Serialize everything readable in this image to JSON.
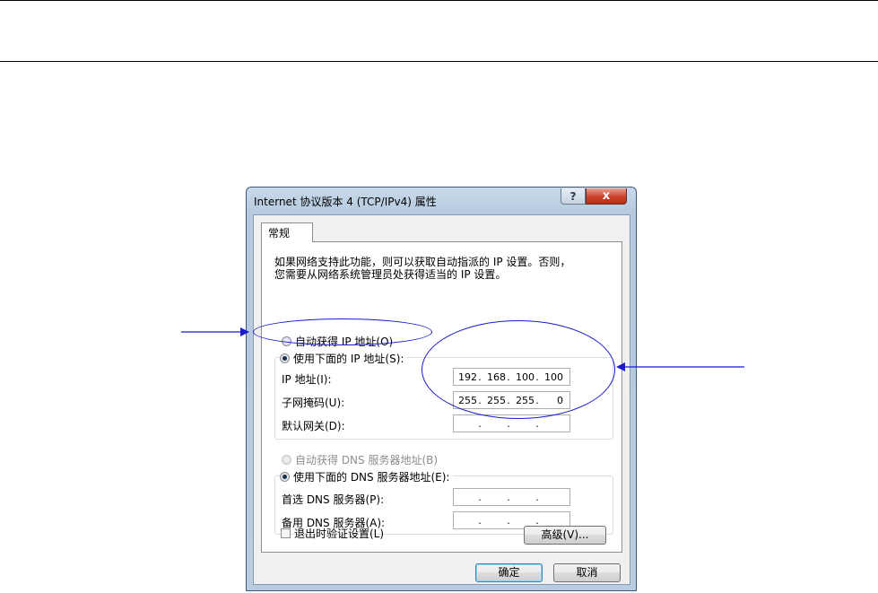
{
  "window": {
    "title": "Internet 协议版本 4 (TCP/IPv4) 属性",
    "help_glyph": "?",
    "close_glyph": "x"
  },
  "tabs": [
    {
      "label": "常规"
    }
  ],
  "description": {
    "line1": "如果网络支持此功能，则可以获取自动指派的 IP 设置。否则，",
    "line2": "您需要从网络系统管理员处获得适当的 IP 设置。"
  },
  "ip_section": {
    "auto_label": "自动获得 IP 地址(O)",
    "manual_label": "使用下面的 IP 地址(S):",
    "selected": "manual",
    "fields": [
      {
        "label": "IP 地址(I):",
        "value": [
          "192",
          "168",
          "100",
          "100"
        ]
      },
      {
        "label": "子网掩码(U):",
        "value": [
          "255",
          "255",
          "255",
          "0"
        ]
      },
      {
        "label": "默认网关(D):",
        "value": [
          "",
          "",
          "",
          ""
        ]
      }
    ]
  },
  "dns_section": {
    "auto_label": "自动获得 DNS 服务器地址(B)",
    "manual_label": "使用下面的 DNS 服务器地址(E):",
    "selected": "manual",
    "fields": [
      {
        "label": "首选 DNS 服务器(P):",
        "value": [
          "",
          "",
          "",
          ""
        ]
      },
      {
        "label": "备用 DNS 服务器(A):",
        "value": [
          "",
          "",
          "",
          ""
        ]
      }
    ]
  },
  "validate_checkbox": {
    "label": "退出时验证设置(L)",
    "checked": false
  },
  "buttons": {
    "advanced": "高级(V)...",
    "ok": "确定",
    "cancel": "取消"
  },
  "annotation_color": "#1a1ad0"
}
